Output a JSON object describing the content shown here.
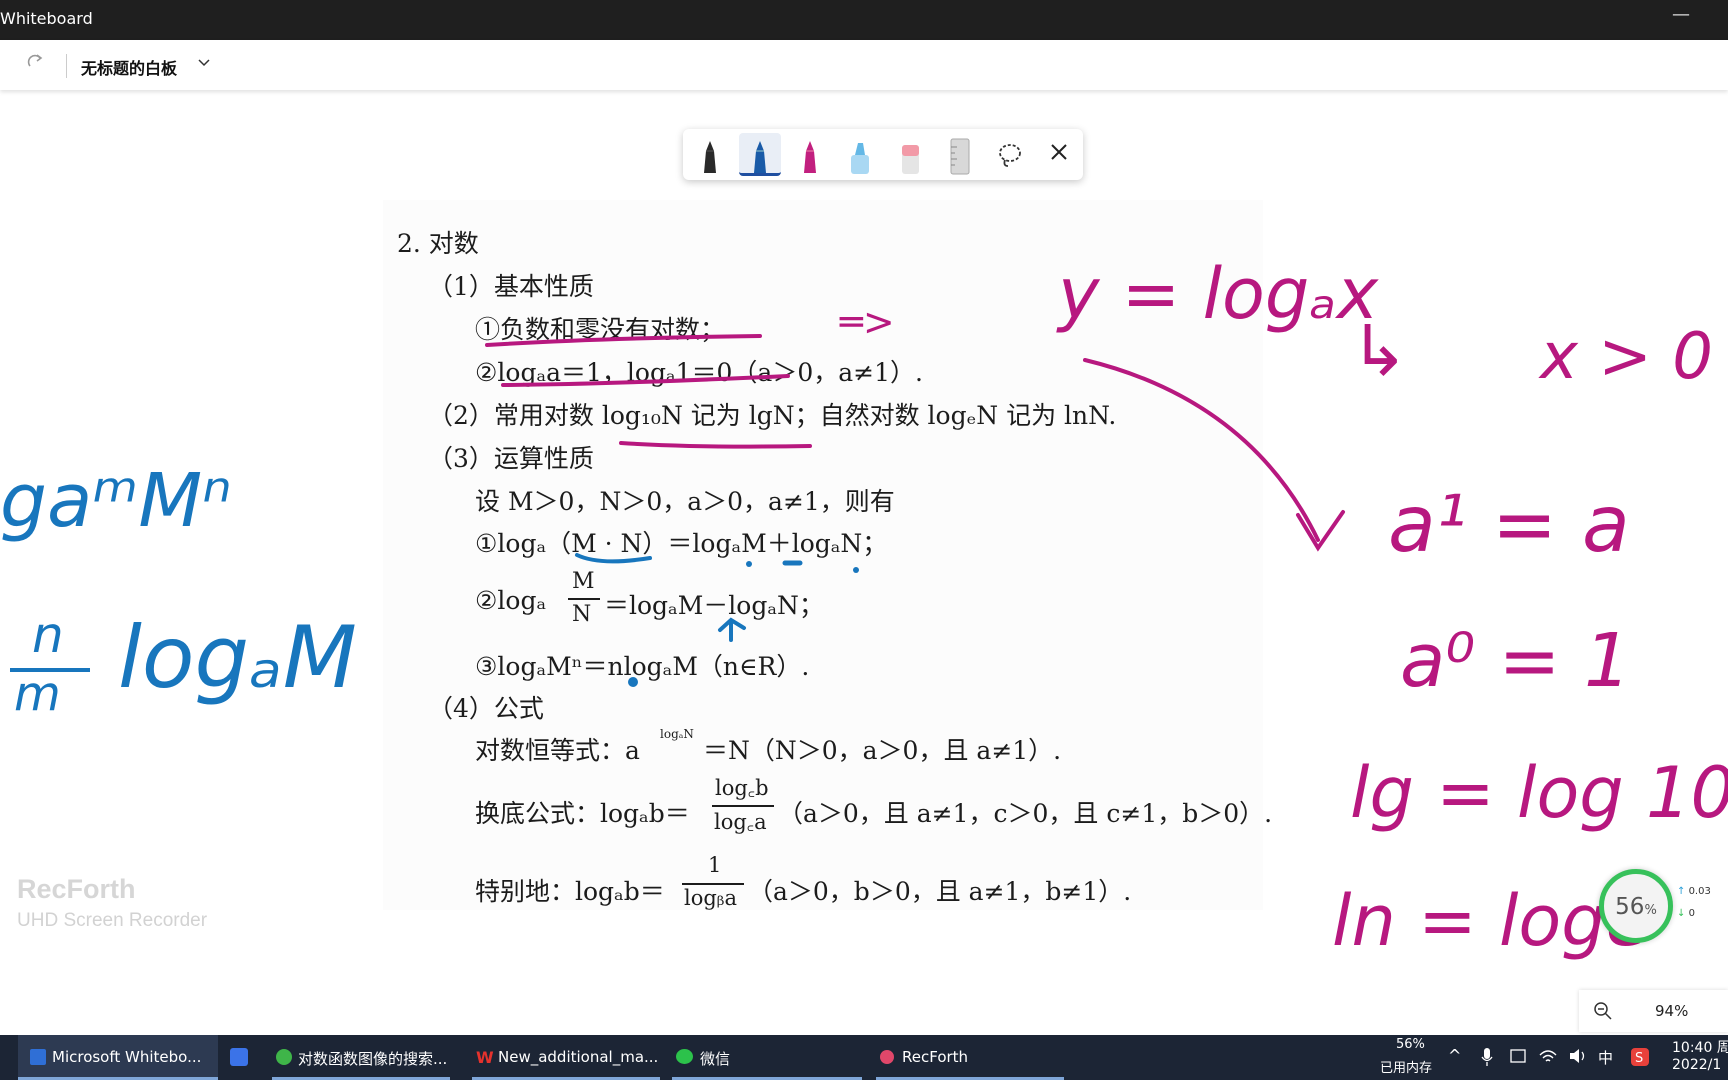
{
  "window": {
    "title": "Whiteboard"
  },
  "header": {
    "board_title": "无标题的白板"
  },
  "document": {
    "lines": [
      "2. 对数",
      "（1）基本性质",
      "①负数和零没有对数；",
      "②logₐa＝1，logₐ1＝0（a＞0，a≠1）.",
      "（2）常用对数 log₁₀N 记为 lgN；自然对数 logₑN 记为 lnN.",
      "（3）运算性质",
      "设 M＞0，N＞0，a＞0，a≠1，则有",
      "①logₐ（M · N）＝logₐM＋logₐN；",
      "②logₐ",
      "＝logₐM－logₐN；",
      "③logₐMⁿ＝nlogₐM（n∈R）.",
      "（4）公式",
      "对数恒等式：a",
      "＝N（N＞0，a＞0，且 a≠1）.",
      "换底公式：logₐb＝",
      "（a＞0，且 a≠1，c＞0，且 c≠1，b＞0）.",
      "特别地：logₐb＝",
      "（a＞0，b＞0，且 a≠1，b≠1）."
    ],
    "frac_mn": {
      "num": "M",
      "den": "N"
    },
    "exp_logaN": "logₐN",
    "frac_change": {
      "num": "log꜀b",
      "den": "log꜀a"
    },
    "frac_special": {
      "num": "1",
      "den": "logᵦa"
    }
  },
  "handwriting": {
    "blue_top": "gaᵐMⁿ",
    "blue_frac_num": "n",
    "blue_frac_den": "m",
    "blue_bottom": "logₐM",
    "pink_equals": "═>",
    "pink_y": "y = logₐx",
    "pink_arrow": "↳",
    "pink_x": "x > 0",
    "pink_a1": "a¹ = a",
    "pink_a0": "a⁰ = 1",
    "pink_lg": "lg = log 10",
    "pink_ln": "ln = loge"
  },
  "watermark": {
    "name": "RecForth",
    "subtitle": "UHD Screen Recorder"
  },
  "widget": {
    "memory_pct": "56",
    "memory_unit": "%",
    "net_up": "0.03",
    "net_down": "0"
  },
  "zoom": {
    "value": "94%"
  },
  "taskbar": {
    "items": [
      {
        "label": "Microsoft Whitebo..."
      },
      {
        "label": "对数函数图像的搜索..."
      },
      {
        "label": "New_additional_ma..."
      },
      {
        "label": "微信"
      },
      {
        "label": "RecForth"
      }
    ],
    "tray": {
      "mem_pct": "56%",
      "mem_label": "已用内存",
      "ime": "中",
      "time": "10:40 周",
      "date": "2022/1"
    }
  },
  "colors": {
    "pen_blue": "#1876bd",
    "pen_pink": "#b7187f",
    "titlebar": "#1f1f1f",
    "taskbar": "#1c2535"
  },
  "icons": [
    "redo-icon",
    "chevron-down-icon",
    "pen-black-icon",
    "pen-blue-icon",
    "pen-pink-icon",
    "highlighter-icon",
    "eraser-icon",
    "ruler-icon",
    "lasso-icon",
    "close-icon",
    "zoom-out-icon",
    "whiteboard-app-icon",
    "browser-icon",
    "wps-icon",
    "wechat-icon",
    "recforth-icon"
  ]
}
